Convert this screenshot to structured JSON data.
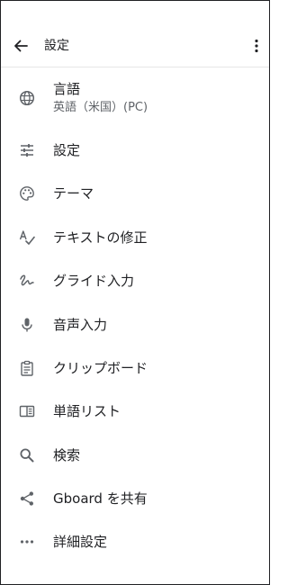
{
  "header": {
    "title": "設定",
    "back_icon": "arrow-back-icon",
    "menu_icon": "more-vert-icon"
  },
  "items": [
    {
      "label": "言語",
      "sublabel": "英語（米国）(PC)",
      "icon": "globe-icon"
    },
    {
      "label": "設定",
      "icon": "tune-icon"
    },
    {
      "label": "テーマ",
      "icon": "palette-icon"
    },
    {
      "label": "テキストの修正",
      "icon": "spellcheck-icon"
    },
    {
      "label": "グライド入力",
      "icon": "gesture-icon"
    },
    {
      "label": "音声入力",
      "icon": "mic-icon"
    },
    {
      "label": "クリップボード",
      "icon": "clipboard-icon"
    },
    {
      "label": "単語リスト",
      "icon": "book-icon"
    },
    {
      "label": "検索",
      "icon": "search-icon"
    },
    {
      "label": "Gboard を共有",
      "icon": "share-icon"
    },
    {
      "label": "詳細設定",
      "icon": "more-horiz-icon"
    }
  ],
  "colors": {
    "text": "#202124",
    "secondary_text": "#5f6368",
    "icon": "#5f6368",
    "divider": "#e6e6e6",
    "background": "#ffffff"
  }
}
